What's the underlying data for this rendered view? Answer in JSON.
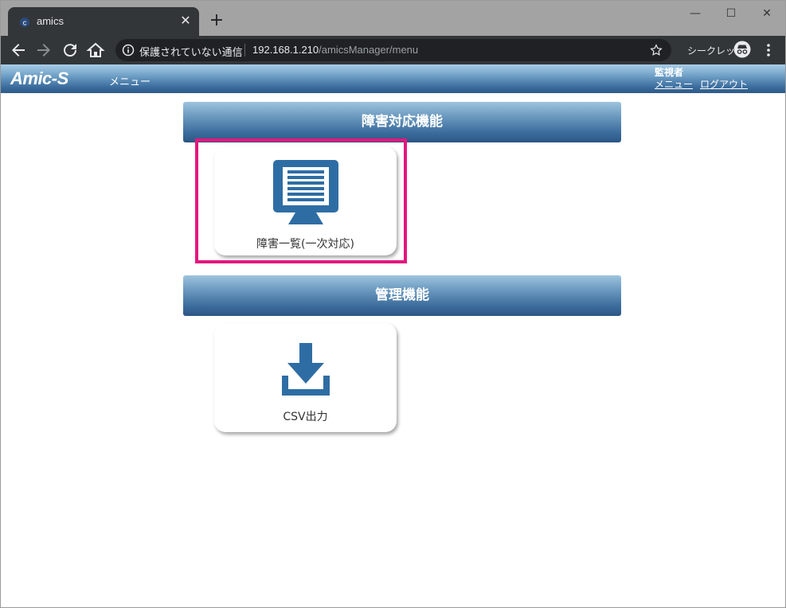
{
  "browser": {
    "tab_title": "amics",
    "tab_close": "✕",
    "new_tab": "+",
    "window_controls": {
      "minimize": "—",
      "maximize": "☐",
      "close": "✕"
    },
    "address_insecure": "保護されていない通信",
    "address_host": "192.168.1.210",
    "address_path": "/amicsManager/menu",
    "incognito_label": "シークレット"
  },
  "app": {
    "logo": "Amic-S",
    "header_menu": "メニュー",
    "user_role": "監視者",
    "link_menu": "メニュー",
    "link_logout": "ログアウト"
  },
  "sections": [
    {
      "title": "障害対応機能",
      "cards": [
        {
          "label": "障害一覧(一次対応)",
          "icon": "monitor-icon"
        }
      ]
    },
    {
      "title": "管理機能",
      "cards": [
        {
          "label": "CSV出力",
          "icon": "download-icon"
        }
      ]
    }
  ],
  "colors": {
    "accent_blue": "#2e6da4",
    "highlight": "#e4167e"
  }
}
